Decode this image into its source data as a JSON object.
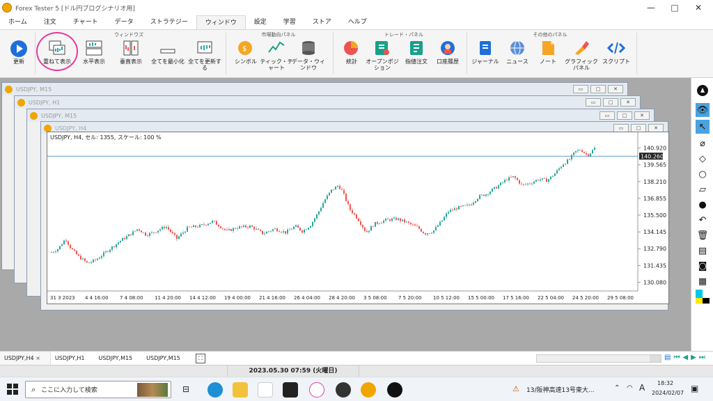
{
  "window": {
    "title": "Forex Tester 5 [ドル円ブログシナリオ用]"
  },
  "menu": [
    "ホーム",
    "注文",
    "チャート",
    "データ",
    "ストラテジー",
    "ウィンドウ",
    "設定",
    "学習",
    "ストア",
    "ヘルプ"
  ],
  "ribbon": {
    "groups": {
      "windows": "ウィンドウズ",
      "market": "市場動向パネル",
      "trade": "トレード・パネル",
      "other": "その他のパネル"
    },
    "buttons": {
      "refresh": "更新",
      "cascade": "重ねて表示",
      "tile_h": "水平表示",
      "tile_v": "垂直表示",
      "minimize_all": "全てを最小化",
      "update_all": "全てを更新する",
      "symbol": "シンボル",
      "tick_chart": "ティック・チャート",
      "data_window": "データ・ウィンドウ",
      "stats": "統計",
      "open_positions": "オープンポジション",
      "pending_orders": "指値注文",
      "account_history": "口座履歴",
      "journal": "ジャーナル",
      "news": "ニュース",
      "notes": "ノート",
      "graphic_panel": "グラフィックパネル",
      "script": "スクリプト"
    }
  },
  "mdi_windows": [
    {
      "title": "USDJPY, M15"
    },
    {
      "title": "USDJPY, H1"
    },
    {
      "title": "USDJPY, M15"
    },
    {
      "title": "USDJPY, H4"
    }
  ],
  "chart": {
    "header": "USDJPY, H4, セル: 1355, スケール: 100 %",
    "current_price": "140.260"
  },
  "chart_data": {
    "type": "candlestick",
    "symbol": "USDJPY",
    "timeframe": "H4",
    "y_ticks": [
      "140.920",
      "139.565",
      "138.210",
      "136.855",
      "135.500",
      "134.145",
      "132.790",
      "131.435",
      "130.080"
    ],
    "ylim": [
      129.6,
      141.4
    ],
    "x_ticks": [
      "31 3 2023",
      "4 4 16:00",
      "7 4 08:00",
      "11 4 20:00",
      "14 4 12:00",
      "19 4 00:00",
      "21 4 16:00",
      "26 4 04:00",
      "28 4 20:00",
      "3 5 08:00",
      "7 5 20:00",
      "10 5 12:00",
      "15 5 00:00",
      "17 5 16:00",
      "22 5 04:00",
      "24 5 20:00",
      "29 5 08:00"
    ],
    "current_price": 140.26,
    "path": [
      [
        0,
        132.5
      ],
      [
        10,
        132.8
      ],
      [
        20,
        133.6
      ],
      [
        28,
        132.8
      ],
      [
        38,
        132.2
      ],
      [
        52,
        131.6
      ],
      [
        64,
        131.9
      ],
      [
        80,
        132.6
      ],
      [
        98,
        133.4
      ],
      [
        112,
        133.9
      ],
      [
        124,
        134.4
      ],
      [
        136,
        133.9
      ],
      [
        150,
        134.2
      ],
      [
        164,
        134.6
      ],
      [
        180,
        133.6
      ],
      [
        196,
        134.5
      ],
      [
        212,
        134.6
      ],
      [
        232,
        135.0
      ],
      [
        252,
        134.2
      ],
      [
        266,
        134.5
      ],
      [
        286,
        134.6
      ],
      [
        304,
        134.0
      ],
      [
        320,
        134.4
      ],
      [
        336,
        134.1
      ],
      [
        350,
        134.6
      ],
      [
        360,
        134.2
      ],
      [
        372,
        134.7
      ],
      [
        382,
        135.6
      ],
      [
        392,
        136.7
      ],
      [
        402,
        137.5
      ],
      [
        412,
        137.9
      ],
      [
        418,
        137.4
      ],
      [
        428,
        136.0
      ],
      [
        440,
        135.2
      ],
      [
        452,
        134.1
      ],
      [
        464,
        134.8
      ],
      [
        480,
        135.1
      ],
      [
        496,
        135.2
      ],
      [
        510,
        134.9
      ],
      [
        526,
        134.5
      ],
      [
        536,
        134.0
      ],
      [
        548,
        134.2
      ],
      [
        560,
        135.0
      ],
      [
        570,
        135.8
      ],
      [
        584,
        136.1
      ],
      [
        600,
        136.3
      ],
      [
        614,
        137.0
      ],
      [
        624,
        137.2
      ],
      [
        640,
        137.8
      ],
      [
        654,
        138.4
      ],
      [
        664,
        138.6
      ],
      [
        676,
        137.9
      ],
      [
        688,
        138.1
      ],
      [
        700,
        138.4
      ],
      [
        712,
        138.3
      ],
      [
        722,
        138.8
      ],
      [
        734,
        139.6
      ],
      [
        744,
        140.0
      ],
      [
        752,
        140.6
      ],
      [
        760,
        140.8
      ],
      [
        770,
        140.3
      ],
      [
        780,
        140.9
      ]
    ]
  },
  "tabs": [
    "USDJPY,H4",
    "USDJPY,H1",
    "USDJPY,M15",
    "USDJPY,M15"
  ],
  "status": {
    "datetime": "2023.05.30 07:59 (火曜日)"
  },
  "taskbar": {
    "search_placeholder": "ここに入力して検索",
    "traffic": "13/阪神高速13号東大...",
    "ime": "A",
    "time": "18:32",
    "date": "2024/02/07"
  },
  "colors": {
    "bull": "#26a69a",
    "bear": "#ef5350",
    "accent": "#1e6fd9",
    "highlight": "#e8389a"
  }
}
